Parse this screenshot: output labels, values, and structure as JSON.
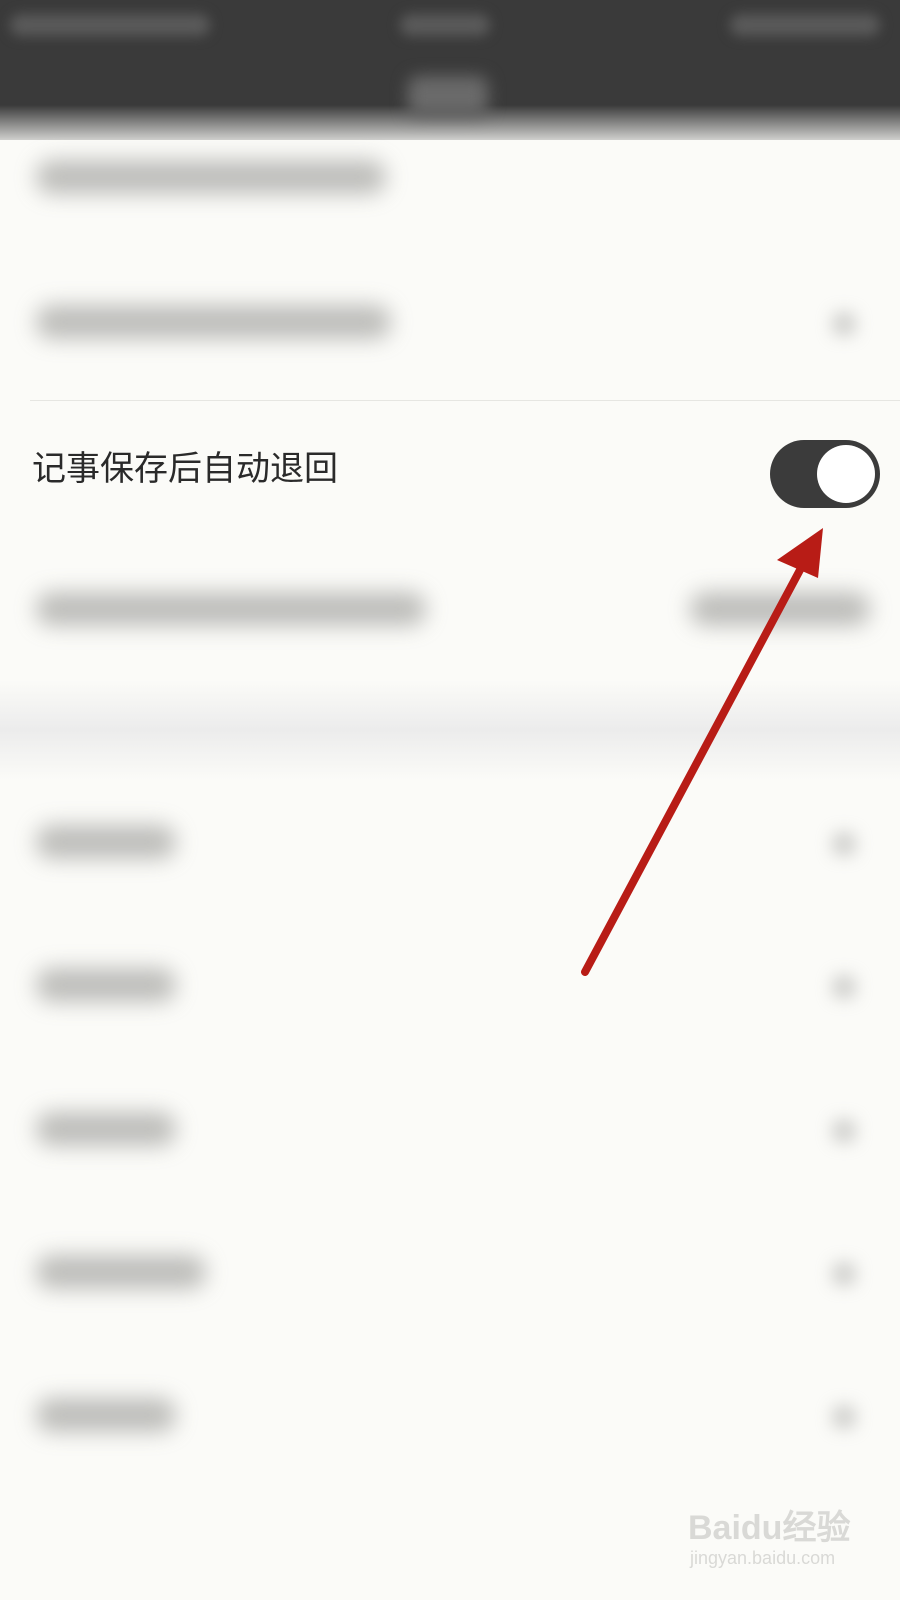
{
  "setting": {
    "label": "记事保存后自动退回",
    "toggle_on": true
  },
  "colors": {
    "header_bg": "#3a3a3a",
    "page_bg": "#fbfbf8",
    "toggle_track": "#3b3b3b",
    "toggle_knob": "#ffffff",
    "annotation_arrow": "#b81c16"
  },
  "watermark": {
    "brand": "Baidu经验",
    "url": "jingyan.baidu.com"
  }
}
